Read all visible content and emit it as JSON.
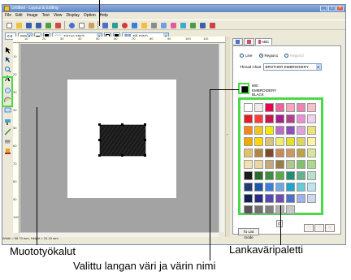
{
  "window": {
    "title": "Untitled - Layout & Editing",
    "controls": [
      "_",
      "□",
      "×"
    ]
  },
  "menu": [
    "File",
    "Edit",
    "Image",
    "Text",
    "View",
    "Display",
    "Option",
    "Help"
  ],
  "toolbar2": {
    "size_value": "0.0",
    "unit": "mm",
    "line_type": "Zigzag Stitch",
    "region_type": "Fill Stitch"
  },
  "ruler": {
    "h_labels": [
      "10",
      "20",
      "30",
      "40",
      "50",
      "60",
      "70",
      "80",
      "90",
      "100",
      "110"
    ],
    "v_labels": [
      "10",
      "20",
      "30",
      "40",
      "50",
      "60",
      "70",
      "80",
      "90",
      "100"
    ]
  },
  "status": {
    "width": "Width = 58.70 mm",
    "height": "Height = 31.10 mm"
  },
  "panel": {
    "tabs": [
      {
        "label": "",
        "icon": "line-tab-icon"
      },
      {
        "label": "",
        "icon": "region-tab-icon"
      },
      {
        "label": "ABC",
        "icon": "text-tab-icon"
      }
    ],
    "radio_line": "Line",
    "radio_region1": "Region1",
    "radio_region2": "Region2",
    "thread_chart_label": "Thread Chart",
    "thread_chart_value": "BROTHER EMBROIDERY",
    "selected": {
      "number": "900",
      "brand": "EMBROIDERY",
      "name": "BLACK",
      "color": "#000000"
    },
    "to_list_mode": "To List mode",
    "fav_icons": [
      "fav-add-icon",
      "fav-remove-icon",
      "fav-heart-icon"
    ]
  },
  "palette_colors": [
    "#ffffff",
    "#ececec",
    "#e8004e",
    "#f0629a",
    "#f7a6bf",
    "#ee84b4",
    "#f6c2c7",
    "#e51c23",
    "#ff3b3b",
    "#c7174f",
    "#a5208a",
    "#b53f8f",
    "#e98fd6",
    "#f0d0ec",
    "#f6861f",
    "#f2c51d",
    "#f1e80a",
    "#b96ec7",
    "#8e4fbd",
    "#e0a2d8",
    "#e8e37a",
    "#f2a900",
    "#ffd700",
    "#d7c37c",
    "#f1ed74",
    "#e5e02a",
    "#ddd565",
    "#fff3a5",
    "#e2c16a",
    "#b38543",
    "#7a4a2a",
    "#c78a5b",
    "#cf9762",
    "#bba34a",
    "#d6e79b",
    "#f2e2b1",
    "#e8d79e",
    "#c6a87a",
    "#9b7b46",
    "#b2c88a",
    "#7ec46d",
    "#a8db8e",
    "#1b1b1b",
    "#2a6b2a",
    "#3e8c3e",
    "#5aa84a",
    "#1f8f6f",
    "#63b28f",
    "#b5e2c8",
    "#223a7a",
    "#1d56a8",
    "#3a7ed9",
    "#6da8e5",
    "#1fa3cf",
    "#66cbdd",
    "#bde6f2",
    "#13214e",
    "#282a89",
    "#5148b3",
    "#6c4db5",
    "#4c6fc9",
    "#9fb2e6",
    "#cdd7f2",
    "#555555",
    "#707070",
    "#7e7e7e",
    "#b0b0b0",
    "#c8c8c8"
  ],
  "captions": {
    "top_text": "Valittu langan väri ja värin nimi",
    "shape_tools": "Muototyökalut",
    "thread_palette": "Lankaväripaletti",
    "selected_color": "Valittu langan väri ja värin nimi"
  }
}
